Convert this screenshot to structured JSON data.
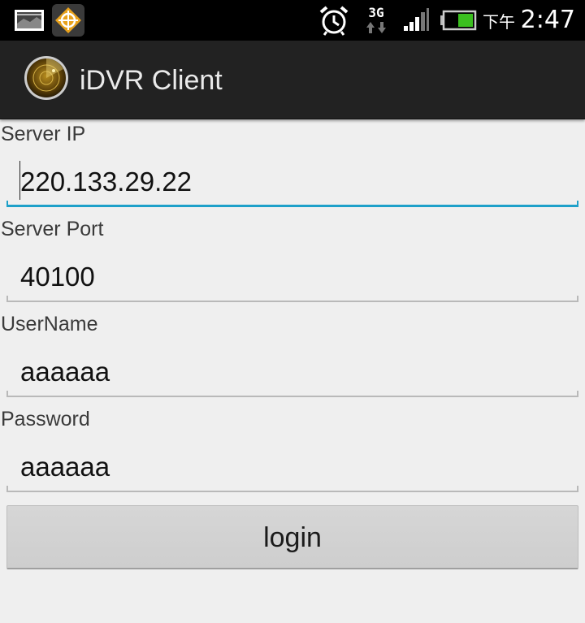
{
  "status_bar": {
    "network_type": "3G",
    "ampm": "下午",
    "time": "2:47",
    "icons": [
      "gallery-icon",
      "gps-app-icon",
      "alarm-icon",
      "3g-data-icon",
      "signal-icon",
      "battery-icon"
    ]
  },
  "action_bar": {
    "app_title": "iDVR Client",
    "app_icon": "radar-icon"
  },
  "form": {
    "server_ip": {
      "label": "Server IP",
      "value": "220.133.29.22"
    },
    "server_port": {
      "label": "Server Port",
      "value": "40100"
    },
    "username": {
      "label": "UserName",
      "value": "aaaaaa"
    },
    "password": {
      "label": "Password",
      "value": "aaaaaa"
    },
    "login_label": "login"
  },
  "colors": {
    "focus_accent": "#1ea0c9",
    "action_bar_bg": "#222222",
    "status_bar_bg": "#000000",
    "body_bg": "#efefef"
  }
}
